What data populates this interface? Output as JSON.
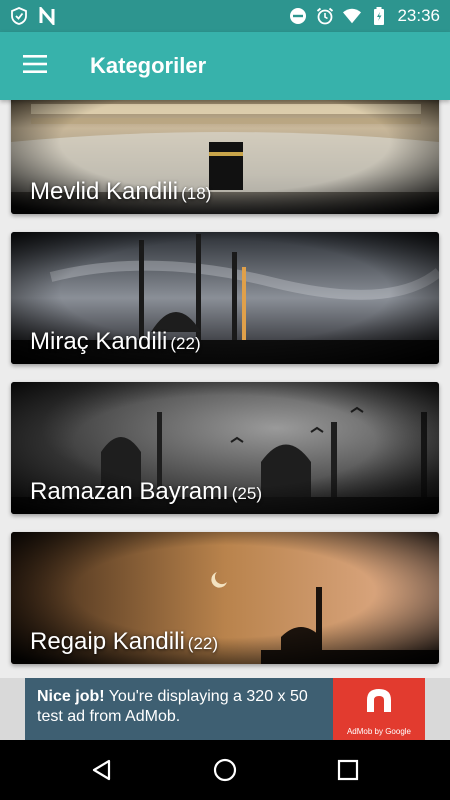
{
  "status_bar": {
    "time": "23:36",
    "left_icons": [
      "shield-icon",
      "n-icon"
    ],
    "right_icons": [
      "dnd-icon",
      "alarm-icon",
      "wifi-icon",
      "battery-icon"
    ]
  },
  "app_bar": {
    "title": "Kategoriler",
    "menu_icon": "hamburger-menu-icon",
    "color": "#37b2ab",
    "status_color": "#2d958f"
  },
  "categories": [
    {
      "name": "Mevlid Kandili",
      "count": "(18)"
    },
    {
      "name": "Miraç Kandili",
      "count": "(22)"
    },
    {
      "name": "Ramazan Bayramı",
      "count": "(25)"
    },
    {
      "name": "Regaip Kandili",
      "count": "(22)"
    }
  ],
  "ad": {
    "bold": "Nice job!",
    "text": " You're displaying a 320 x 50 test ad from AdMob.",
    "logo_text": "AdMob by Google",
    "background": "#3e5f72",
    "logo_color": "#e23b2f"
  },
  "nav_bar": {
    "buttons": [
      "back-icon",
      "home-icon",
      "recents-icon"
    ]
  }
}
